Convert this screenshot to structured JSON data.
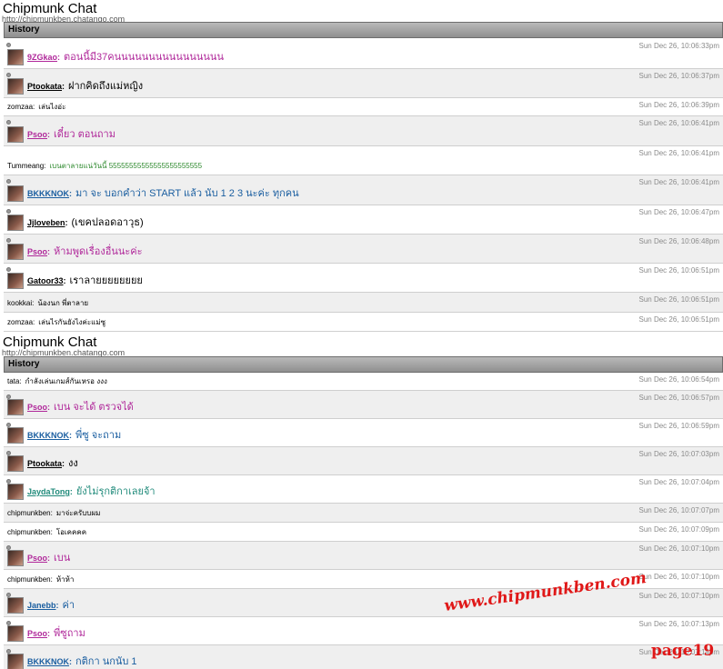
{
  "panels": [
    {
      "title": "Chipmunk Chat",
      "url": "http://chipmunkben.chatango.com",
      "history_label": "History",
      "messages": [
        {
          "user": "9ZGkao",
          "text": "ตอนนี้มี37คนนนนนนนนนนนนนนนน",
          "time": "Sun Dec 26, 10:06:33pm",
          "color": "#b0289a",
          "avatar": true,
          "bg": "plain"
        },
        {
          "user": "Ptookata",
          "text": "ฝากคิดถึงแม่หญิง",
          "time": "Sun Dec 26, 10:06:37pm",
          "color": "#000000",
          "avatar": true,
          "bg": "alt"
        },
        {
          "user": "zomzaa",
          "text": "เล่นไงอ่ะ",
          "time": "Sun Dec 26, 10:06:39pm",
          "color": "#000000",
          "avatar": false,
          "bg": "plain"
        },
        {
          "user": "Psoo",
          "text": "เดี๋ยว ตอนถาม",
          "time": "Sun Dec 26, 10:06:41pm",
          "color": "#b0289a",
          "avatar": true,
          "bg": "alt"
        },
        {
          "user": "Tummeang",
          "text": "เบนตาลายแน่วันนี้ 55555555555555555555555",
          "time": "Sun Dec 26, 10:06:41pm",
          "color": "#2f8a2f",
          "avatar": false,
          "bg": "plain"
        },
        {
          "user": "BKKKNOK",
          "text": "มา จะ บอกคำว่า START แล้ว นับ 1 2 3 นะค่ะ ทุกคน",
          "time": "Sun Dec 26, 10:06:41pm",
          "color": "#1a5ea0",
          "avatar": true,
          "bg": "alt"
        },
        {
          "user": "Jjloveben",
          "text": "(เขคปลอดอาวุธ)",
          "time": "Sun Dec 26, 10:06:47pm",
          "color": "#000000",
          "avatar": true,
          "bg": "plain"
        },
        {
          "user": "Psoo",
          "text": "ห้ามพูดเรื่องอื่นนะค่ะ",
          "time": "Sun Dec 26, 10:06:48pm",
          "color": "#b0289a",
          "avatar": true,
          "bg": "alt"
        },
        {
          "user": "Gatoor33",
          "text": "เราลายยยยยยยย",
          "time": "Sun Dec 26, 10:06:51pm",
          "color": "#000000",
          "avatar": true,
          "bg": "plain"
        },
        {
          "user": "kookkai",
          "text": "น้องนก พี่ตาลาย",
          "time": "Sun Dec 26, 10:06:51pm",
          "color": "#000000",
          "avatar": false,
          "bg": "alt"
        },
        {
          "user": "zomzaa",
          "text": "เล่นไรกันยังไงค่ะแม่ซู",
          "time": "Sun Dec 26, 10:06:51pm",
          "color": "#000000",
          "avatar": false,
          "bg": "plain"
        }
      ]
    },
    {
      "title": "Chipmunk Chat",
      "url": "http://chipmunkben.chatango.com",
      "history_label": "History",
      "messages": [
        {
          "user": "tata",
          "text": "กำลังเล่นเกมส์กันเหรอ งงง",
          "time": "Sun Dec 26, 10:06:54pm",
          "color": "#000000",
          "avatar": false,
          "bg": "plain"
        },
        {
          "user": "Psoo",
          "text": "เบน จะได้ ตรวจได้",
          "time": "Sun Dec 26, 10:06:57pm",
          "color": "#b0289a",
          "avatar": true,
          "bg": "alt"
        },
        {
          "user": "BKKKNOK",
          "text": "พี่ซู จะถาม",
          "time": "Sun Dec 26, 10:06:59pm",
          "color": "#1a5ea0",
          "avatar": true,
          "bg": "plain"
        },
        {
          "user": "Ptookata",
          "text": "งง",
          "time": "Sun Dec 26, 10:07:03pm",
          "color": "#000000",
          "avatar": true,
          "bg": "alt"
        },
        {
          "user": "JaydaTong",
          "text": "ยังไม่รุกติกาเลยจ้า",
          "time": "Sun Dec 26, 10:07:04pm",
          "color": "#1f8a7a",
          "avatar": true,
          "bg": "plain"
        },
        {
          "user": "chipmunkben",
          "text": "มาจ่ะครับบผม",
          "time": "Sun Dec 26, 10:07:07pm",
          "color": "#000000",
          "avatar": false,
          "bg": "alt"
        },
        {
          "user": "chipmunkben",
          "text": "โอเคคคค",
          "time": "Sun Dec 26, 10:07:09pm",
          "color": "#000000",
          "avatar": false,
          "bg": "plain"
        },
        {
          "user": "Psoo",
          "text": "เบน",
          "time": "Sun Dec 26, 10:07:10pm",
          "color": "#b0289a",
          "avatar": true,
          "bg": "alt"
        },
        {
          "user": "chipmunkben",
          "text": "ห้าห้า",
          "time": "Sun Dec 26, 10:07:10pm",
          "color": "#000000",
          "avatar": false,
          "bg": "plain"
        },
        {
          "user": "Janebb",
          "text": "ค่า",
          "time": "Sun Dec 26, 10:07:10pm",
          "color": "#1a5ea0",
          "avatar": true,
          "bg": "alt"
        },
        {
          "user": "Psoo",
          "text": "พี่ซูถาม",
          "time": "Sun Dec 26, 10:07:13pm",
          "color": "#b0289a",
          "avatar": true,
          "bg": "plain"
        },
        {
          "user": "BKKKNOK",
          "text": "กติกา นกนับ 1",
          "time": "Sun Dec 26, 10:07:14pm",
          "color": "#1a5ea0",
          "avatar": true,
          "bg": "alt"
        }
      ]
    }
  ],
  "watermark": "www.chipmunkben.com",
  "page_label": "page19"
}
